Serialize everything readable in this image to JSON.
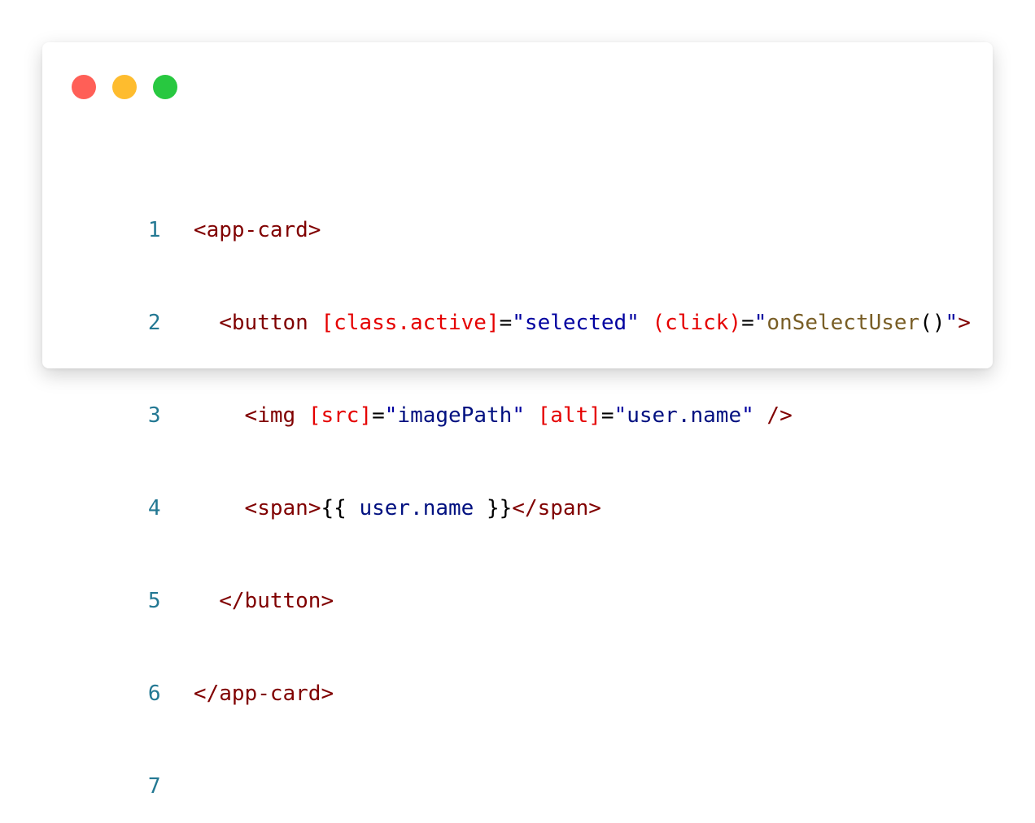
{
  "window": {
    "controls": [
      {
        "name": "close",
        "color": "#ff5f57"
      },
      {
        "name": "minimize",
        "color": "#febc2e"
      },
      {
        "name": "maximize",
        "color": "#28c840"
      }
    ]
  },
  "code": {
    "lines": [
      {
        "number": "1",
        "tokens": [
          {
            "t": "tag",
            "v": "<app-card>"
          }
        ]
      },
      {
        "number": "2",
        "tokens": [
          {
            "t": "pun",
            "v": "  "
          },
          {
            "t": "tag",
            "v": "<button"
          },
          {
            "t": "pun",
            "v": " "
          },
          {
            "t": "attr",
            "v": "[class.active]"
          },
          {
            "t": "eq",
            "v": "="
          },
          {
            "t": "str",
            "v": "\"selected\""
          },
          {
            "t": "pun",
            "v": " "
          },
          {
            "t": "attr",
            "v": "(click)"
          },
          {
            "t": "eq",
            "v": "="
          },
          {
            "t": "str",
            "v": "\""
          },
          {
            "t": "fn",
            "v": "onSelectUser"
          },
          {
            "t": "pun",
            "v": "()"
          },
          {
            "t": "str",
            "v": "\""
          },
          {
            "t": "tag",
            "v": ">"
          }
        ]
      },
      {
        "number": "3",
        "tokens": [
          {
            "t": "pun",
            "v": "    "
          },
          {
            "t": "tag",
            "v": "<img"
          },
          {
            "t": "pun",
            "v": " "
          },
          {
            "t": "attr",
            "v": "[src]"
          },
          {
            "t": "eq",
            "v": "="
          },
          {
            "t": "str",
            "v": "\""
          },
          {
            "t": "var",
            "v": "imagePath"
          },
          {
            "t": "str",
            "v": "\""
          },
          {
            "t": "pun",
            "v": " "
          },
          {
            "t": "attr",
            "v": "[alt]"
          },
          {
            "t": "eq",
            "v": "="
          },
          {
            "t": "str",
            "v": "\""
          },
          {
            "t": "var",
            "v": "user.name"
          },
          {
            "t": "str",
            "v": "\""
          },
          {
            "t": "pun",
            "v": " "
          },
          {
            "t": "tag",
            "v": "/>"
          }
        ]
      },
      {
        "number": "4",
        "tokens": [
          {
            "t": "pun",
            "v": "    "
          },
          {
            "t": "tag",
            "v": "<span>"
          },
          {
            "t": "pun",
            "v": "{{ "
          },
          {
            "t": "var",
            "v": "user.name"
          },
          {
            "t": "pun",
            "v": " }}"
          },
          {
            "t": "tag",
            "v": "</span>"
          }
        ]
      },
      {
        "number": "5",
        "tokens": [
          {
            "t": "pun",
            "v": "  "
          },
          {
            "t": "tag",
            "v": "</button>"
          }
        ]
      },
      {
        "number": "6",
        "tokens": [
          {
            "t": "tag",
            "v": "</app-card>"
          }
        ]
      },
      {
        "number": "7",
        "tokens": []
      }
    ]
  }
}
